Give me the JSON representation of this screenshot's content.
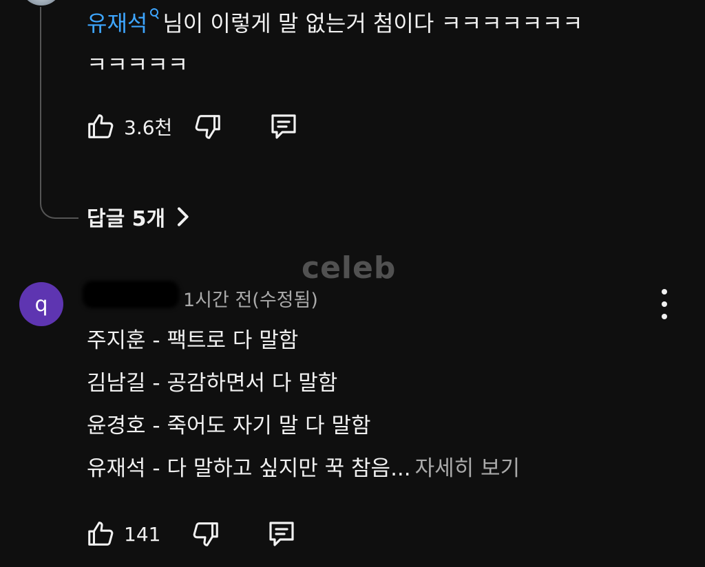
{
  "reply": {
    "mention": "유재석",
    "text_line1": "님이 이렇게 말 없는거 첨이다 ㅋㅋㅋㅋㅋㅋㅋ",
    "text_line2": "ㅋㅋㅋㅋㅋ",
    "likes": "3.6천"
  },
  "replies_link": {
    "label": "답글 5개"
  },
  "watermark": "celeb",
  "comment": {
    "avatar_letter": "q",
    "meta": "1시간 전(수정됨)",
    "lines": [
      "주지훈 - 팩트로 다 말함",
      "김남길 - 공감하면서 다 말함",
      "윤경호 - 죽어도 자기 말 다 말함",
      "유재석 - 다 말하고 싶지만  꾹 참음..."
    ],
    "read_more": "자세히 보기",
    "likes": "141"
  },
  "icons": {
    "like": "thumbs-up-icon",
    "dislike": "thumbs-down-icon",
    "reply": "comment-icon",
    "more": "more-vert-icon",
    "chevron": "chevron-right-icon",
    "mention": "search-icon"
  },
  "colors": {
    "background": "#0f0f0f",
    "text": "#f1f1f1",
    "secondary_text": "#aaaaaa",
    "mention": "#3ea6ff",
    "avatar": "#5e35b1"
  }
}
